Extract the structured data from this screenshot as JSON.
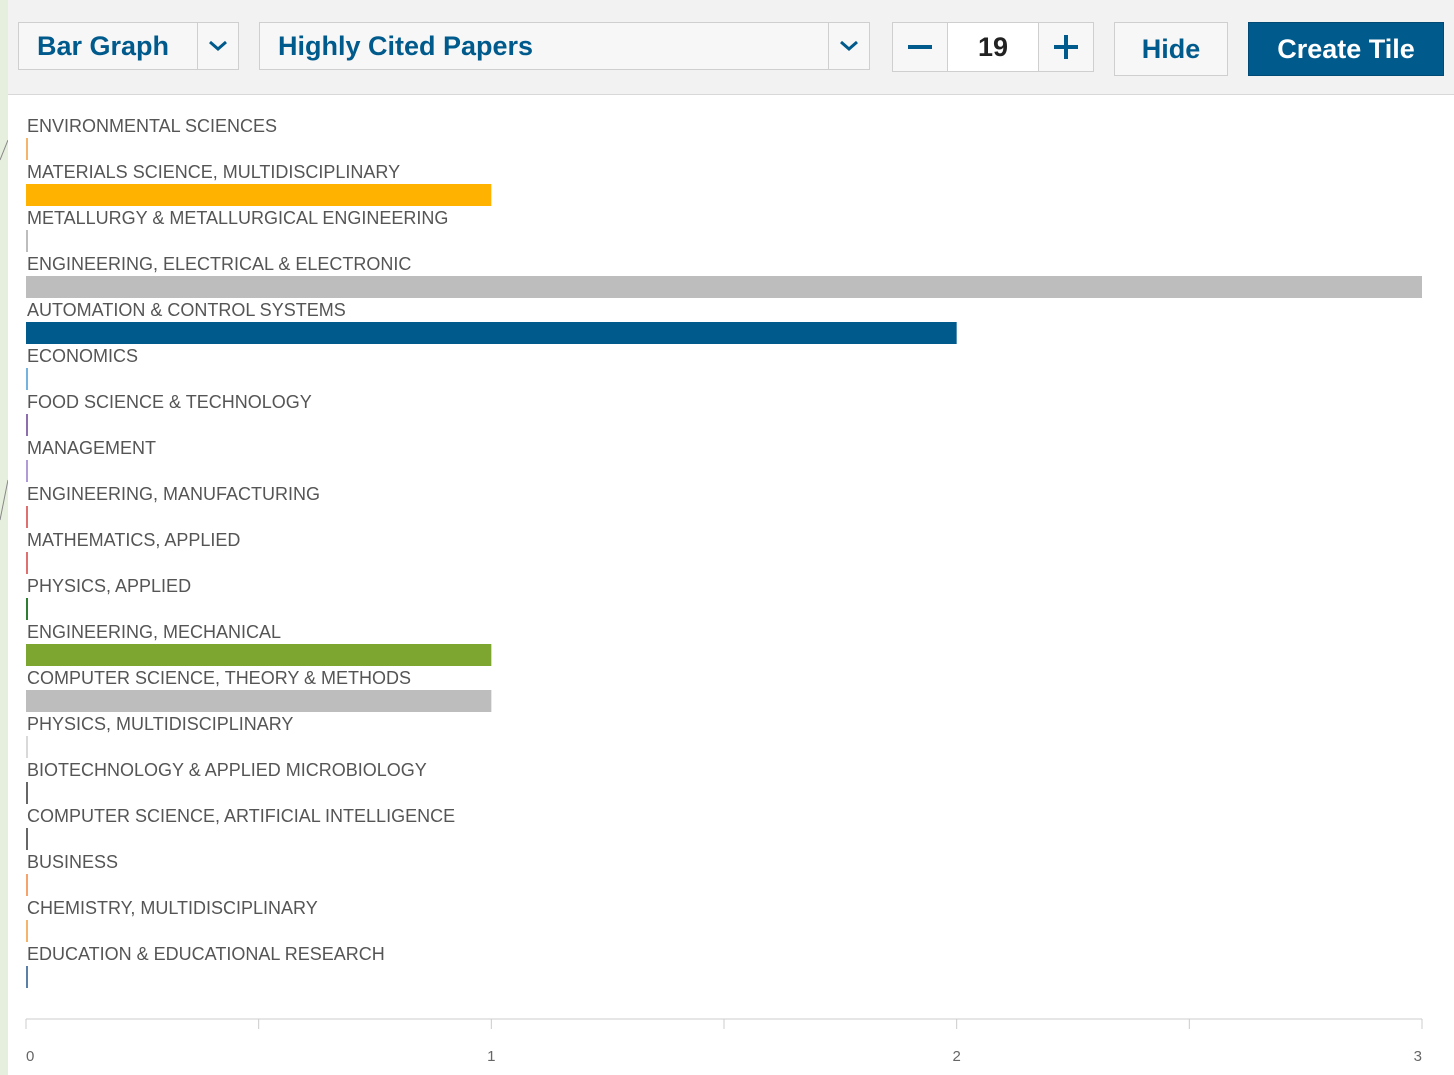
{
  "toolbar": {
    "chart_type": "Bar Graph",
    "metric": "Highly Cited Papers",
    "count": "19",
    "hide_label": "Hide",
    "create_label": "Create Tile",
    "accent_color": "#005a8c"
  },
  "chart_data": {
    "type": "bar",
    "orientation": "horizontal",
    "categories": [
      "ENVIRONMENTAL SCIENCES",
      "MATERIALS SCIENCE, MULTIDISCIPLINARY",
      "METALLURGY & METALLURGICAL ENGINEERING",
      "ENGINEERING, ELECTRICAL & ELECTRONIC",
      "AUTOMATION & CONTROL SYSTEMS",
      "ECONOMICS",
      "FOOD SCIENCE & TECHNOLOGY",
      "MANAGEMENT",
      "ENGINEERING, MANUFACTURING",
      "MATHEMATICS, APPLIED",
      "PHYSICS, APPLIED",
      "ENGINEERING, MECHANICAL",
      "COMPUTER SCIENCE, THEORY & METHODS",
      "PHYSICS, MULTIDISCIPLINARY",
      "BIOTECHNOLOGY & APPLIED MICROBIOLOGY",
      "COMPUTER SCIENCE, ARTIFICIAL INTELLIGENCE",
      "BUSINESS",
      "CHEMISTRY, MULTIDISCIPLINARY",
      "EDUCATION & EDUCATIONAL RESEARCH"
    ],
    "values": [
      0,
      1,
      0,
      3,
      2,
      0,
      0,
      0,
      0,
      0,
      0,
      1,
      1,
      0,
      0,
      0,
      0,
      0,
      0
    ],
    "colors": [
      "#f5b36b",
      "#ffb300",
      "#bdbdbd",
      "#bdbdbd",
      "#005a8c",
      "#74b3e0",
      "#8e6fae",
      "#b19ad8",
      "#e07070",
      "#e07070",
      "#2e7d32",
      "#7ca630",
      "#bdbdbd",
      "#d9d9d9",
      "#666666",
      "#666666",
      "#f5a36b",
      "#f5b36b",
      "#5a7fa8"
    ],
    "xlim": [
      0,
      3
    ],
    "xticks": [
      "0",
      "1",
      "2",
      "3"
    ],
    "grid": false,
    "legend": "none"
  }
}
